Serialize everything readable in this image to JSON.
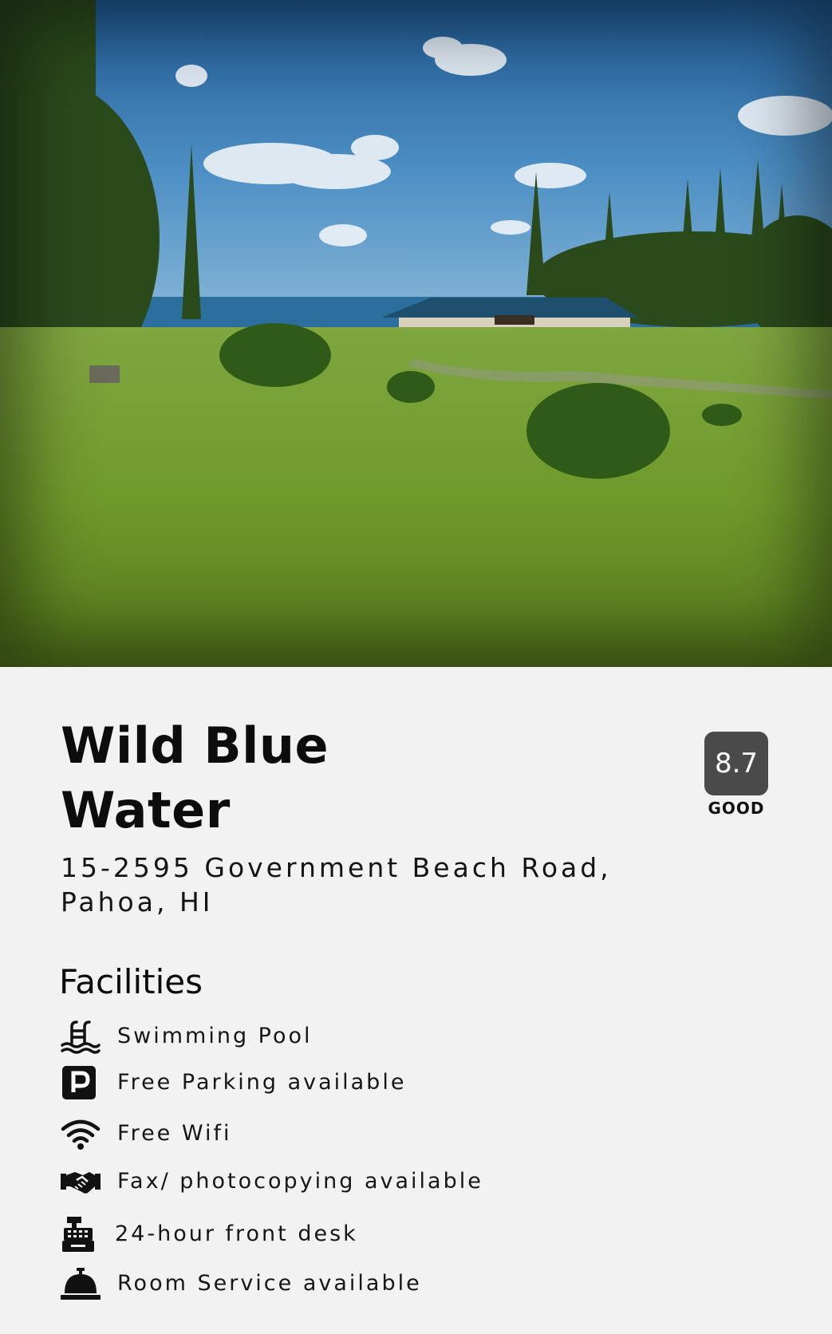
{
  "hotel": {
    "name": "Wild Blue Water",
    "address": "15-2595 Government Beach Road, Pahoa, HI",
    "rating": {
      "score": "8.7",
      "label": "GOOD"
    }
  },
  "facilities": {
    "title": "Facilities",
    "items": [
      {
        "icon": "swimming-pool-icon",
        "label": "Swimming Pool"
      },
      {
        "icon": "parking-icon",
        "label": "Free Parking available"
      },
      {
        "icon": "wifi-icon",
        "label": "Free Wifi"
      },
      {
        "icon": "handshake-icon",
        "label": "Fax/ photocopying available"
      },
      {
        "icon": "cash-register-icon",
        "label": "24-hour front desk"
      },
      {
        "icon": "service-bell-icon",
        "label": "Room Service available"
      }
    ]
  },
  "colors": {
    "background": "#f2f2f2",
    "rating_badge": "#4a4a4a",
    "text": "#0f0f0f"
  }
}
